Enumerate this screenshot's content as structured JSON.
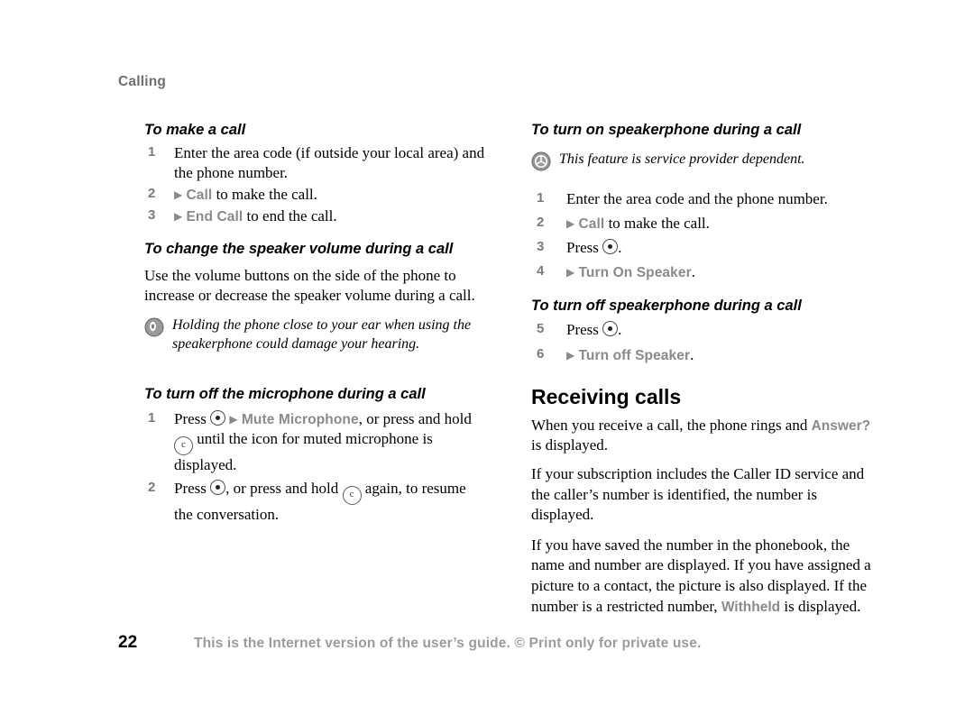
{
  "chapter": "Calling",
  "left_column": {
    "section1": {
      "heading": "To make a call",
      "steps": [
        {
          "num": "1",
          "text_before": "Enter the area code (if outside your local area) and the phone number.",
          "menu": "",
          "text_after": ""
        },
        {
          "num": "2",
          "text_before": "",
          "menu": "Call",
          "text_after": " to make the call."
        },
        {
          "num": "3",
          "text_before": "",
          "menu": "End Call",
          "text_after": " to end the call."
        }
      ]
    },
    "section2": {
      "heading": "To change the speaker volume during a call",
      "paragraph": "Use the volume buttons on the side of the phone to increase or decrease the speaker volume during a call."
    },
    "note1": "Holding the phone close to your ear when using the speakerphone could damage your hearing.",
    "section3": {
      "heading": "To turn off the microphone during a call",
      "step1_a": "Press ",
      "step1_menu": "Mute Microphone",
      "step1_b": ", or press and hold ",
      "step1_c": " until the icon for muted microphone is displayed.",
      "step1_num": "1",
      "step2_num": "2",
      "step2_a": "Press ",
      "step2_b": ", or press and hold ",
      "step2_c": " again, to resume the conversation."
    }
  },
  "right_column": {
    "section1": {
      "heading": "To turn on speakerphone during a call",
      "note": "This feature is service provider dependent.",
      "steps": [
        {
          "num": "1",
          "text_before": "Enter the area code and the phone number.",
          "menu": "",
          "text_after": ""
        },
        {
          "num": "2",
          "text_before": "",
          "menu": "Call",
          "text_after": " to make the call."
        },
        {
          "num": "3",
          "text_before": "Press ",
          "menu": "",
          "text_after": "."
        },
        {
          "num": "4",
          "text_before": "",
          "menu": "Turn On Speaker",
          "text_after": "."
        }
      ]
    },
    "section2": {
      "heading": "To turn off speakerphone during a call",
      "steps": [
        {
          "num": "5",
          "text_before": "Press ",
          "menu": "",
          "text_after": "."
        },
        {
          "num": "6",
          "text_before": "",
          "menu": "Turn off Speaker",
          "text_after": "."
        }
      ]
    },
    "section3": {
      "heading": "Receiving calls",
      "para1_a": "When you receive a call, the phone rings and ",
      "para1_menu": "Answer?",
      "para1_b": " is displayed.",
      "para2": "If your subscription includes the Caller ID service and the caller’s number is identified, the number is displayed.",
      "para3_a": "If you have saved the number in the phonebook, the name and number are displayed. If you have assigned a picture to a contact, the picture is also displayed. If the number is a restricted number, ",
      "para3_menu": "Withheld",
      "para3_b": " is displayed."
    }
  },
  "footer": {
    "page_number": "22",
    "text": "This is the Internet version of the user’s guide. © Print only for private use."
  }
}
